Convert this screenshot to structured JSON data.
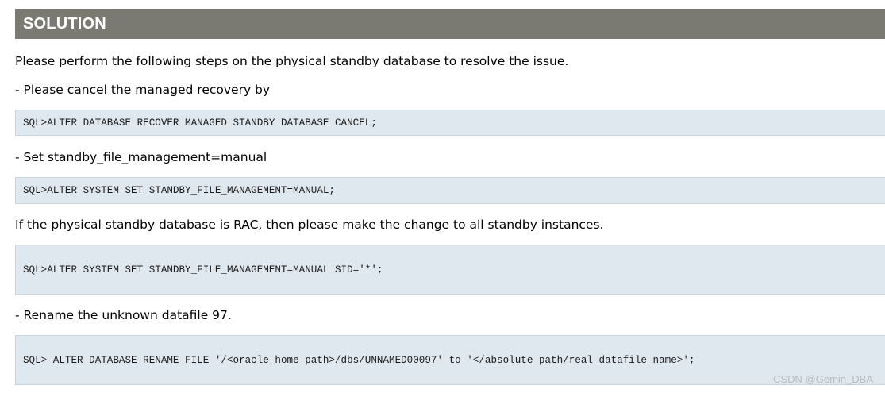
{
  "header": {
    "title": "SOLUTION"
  },
  "content": {
    "intro": "Please perform the following steps on the physical standby database to resolve the issue.",
    "step1_text": "- Please cancel the managed recovery by",
    "step1_code": "SQL>ALTER DATABASE RECOVER MANAGED STANDBY DATABASE CANCEL;",
    "step2_text": "- Set standby_file_management=manual",
    "step2_code": "SQL>ALTER SYSTEM SET STANDBY_FILE_MANAGEMENT=MANUAL;",
    "rac_text": "If the physical standby database is RAC, then please make the change to all standby instances.",
    "rac_code": "SQL>ALTER SYSTEM SET STANDBY_FILE_MANAGEMENT=MANUAL SID='*';",
    "step3_text": "- Rename the unknown datafile 97.",
    "step3_code": "SQL> ALTER DATABASE RENAME FILE '/<oracle_home path>/dbs/UNNAMED00097' to '</absolute path/real datafile name>';"
  },
  "watermark": "CSDN @Gemin_DBA",
  "colors": {
    "header_bg": "#7a7a72",
    "code_bg": "#e0e8ef"
  }
}
